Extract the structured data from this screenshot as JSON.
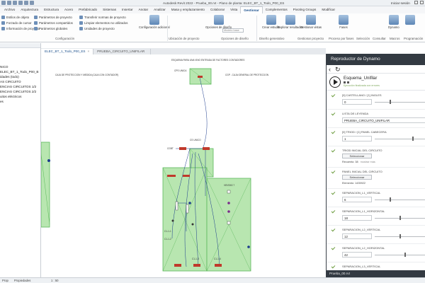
{
  "window": {
    "title": "Autodesk Revit 2022 - Prueba_00.rvt - Plano de planta: ELEC_BT_1_Todo_P00_ES",
    "user": "Iniciar sesión"
  },
  "ribbon": {
    "tabs": [
      "Archivo",
      "Arquitectura",
      "Estructura",
      "Acero",
      "Prefabricado",
      "Sistemas",
      "Insertar",
      "Anotar",
      "Analizar",
      "Masa y emplazamiento",
      "Colaborar",
      "Vista",
      "Gestionar",
      "Complementos",
      "Pivoting Groups",
      "Modificar"
    ],
    "active_tab": "Gestionar",
    "list_a": [
      "Estilos de objeto",
      "Forzado de cursor",
      "Información de proyecto"
    ],
    "list_b": [
      "Parámetros de proyecto",
      "Parámetros compartidos",
      "Parámetros globales"
    ],
    "list_c": [
      "Transferir normas de proyecto",
      "Limpiar elementos no utilizados",
      "Unidades de proyecto"
    ],
    "config_button": "Configuración adicional",
    "location_label": "Ubicación de proyecto",
    "design_options_button": "Opciones de diseño",
    "main_model_dropdown": "Modelo base",
    "create_study_button": "Crear estudio",
    "explore_button": "Explorar resultados",
    "manage_views_button": "Gestionar vistas",
    "phases_button": "Fases",
    "dynamo_button": "Dynamo",
    "player_button": "Reproductor de Dynamo",
    "group_labels": {
      "configuration": "Configuración",
      "project_location": "Ubicación de proyecto",
      "design_options": "Opciones de diseño",
      "generative_design": "Diseño generativo",
      "manage_project": "Gestionar proyecto",
      "phasing": "Proceso por fases",
      "selection": "Selección",
      "query": "Consultar",
      "macros": "Macros",
      "visual_programming": "Programación"
    }
  },
  "project_browser": {
    "items": [
      "NICO",
      "ELEC_BT_1_Todo_P00_B",
      "idades (todo)",
      "AS CIRCUITO",
      "ENCIAS CIRCUITOS 1/2",
      "ENCIAS CIRCUITOS 2/2",
      "uitos eléctricos",
      "es"
    ]
  },
  "view_tabs": [
    {
      "label": "ELEC_BT_1_Todo_P00_ES",
      "close": "×"
    },
    {
      "label": "PRUEBA_CIRCUITO_UNIFILAR",
      "close": ""
    }
  ],
  "canvas": {
    "notes": {
      "top": "ESQUEMA PARA UNA VINO ENTRADA DE FACTORES CONTADORES",
      "left": "CAJA DE PROTECCION Y MEDIDA (CAJA CON CONTADOR)",
      "right": "CGP - CAJA GENERAL DE PROTECCION",
      "cps_label": "CPS UNICA",
      "cgbt_label": "CGBT",
      "cs_label": "CS UNICO",
      "room_label": "VENTAS 7",
      "c1": "C1-1-1",
      "c2": "C1-1-2",
      "c3": "C1-1-3",
      "c4": "C1-1-4"
    }
  },
  "dynamo_player": {
    "title": "Reproductor de Dynamo",
    "back_icon": "‹",
    "refresh_icon": "↻",
    "script_name": "Esquema_Unifilar",
    "script_status": "Ejecución finalizada con errores",
    "inputs": [
      {
        "label": "[0] CASTELLANO / [1] INGLES",
        "value": "0",
        "kind": "slider",
        "slider_pos": 0.3
      },
      {
        "label": "LISTA DE LEYENDA",
        "value": "PRUEBA_CIRCUITO_UNIFILAR",
        "kind": "text"
      },
      {
        "label": "[0] TRIOD / [1] PANEL CABECERA",
        "value": "1",
        "kind": "slider",
        "slider_pos": 0.75
      },
      {
        "label": "TRIOD INICIAL DEL CIRCUITO",
        "button": "Seleccionar",
        "sub_key": "Recuento",
        "sub_value": "38",
        "sub_extra": "mostrar más",
        "kind": "select"
      },
      {
        "label": "PANEL INICIAL DEL CIRCUITO",
        "button": "Seleccionar",
        "sub_key": "Elemento",
        "sub_value": "1435922",
        "sub_extra": "",
        "kind": "select"
      },
      {
        "label": "SEPARACION_L1_VERTICAL",
        "value": "6",
        "kind": "slider",
        "slider_pos": 0.3
      },
      {
        "label": "SEPARACION_L1_HORIZONTAL",
        "value": "18",
        "kind": "slider",
        "slider_pos": 0.5
      },
      {
        "label": "SEPARACION_L2_VERTICAL",
        "value": "12",
        "kind": "slider",
        "slider_pos": 0.5
      },
      {
        "label": "SEPARACION_L2_HORIZONTAL",
        "value": "42",
        "kind": "slider",
        "slider_pos": 0.6
      },
      {
        "label": "SEPARACION_L3_VERTICAL",
        "value": "",
        "kind": "slider",
        "slider_pos": 0.5
      }
    ],
    "footer": "Prueba_00.rvt"
  },
  "status_bar": {
    "tabs": [
      "Prop",
      "Propiedades"
    ],
    "scale": "1 : 50"
  },
  "colors": {
    "room_fill": "#b8e6b0",
    "room_stroke": "#5cb85c",
    "panel_red": "#c0392b",
    "wire_blue": "#1a3a8c",
    "dynamo_header": "#333a42",
    "check_green": "#6b9b3c"
  }
}
